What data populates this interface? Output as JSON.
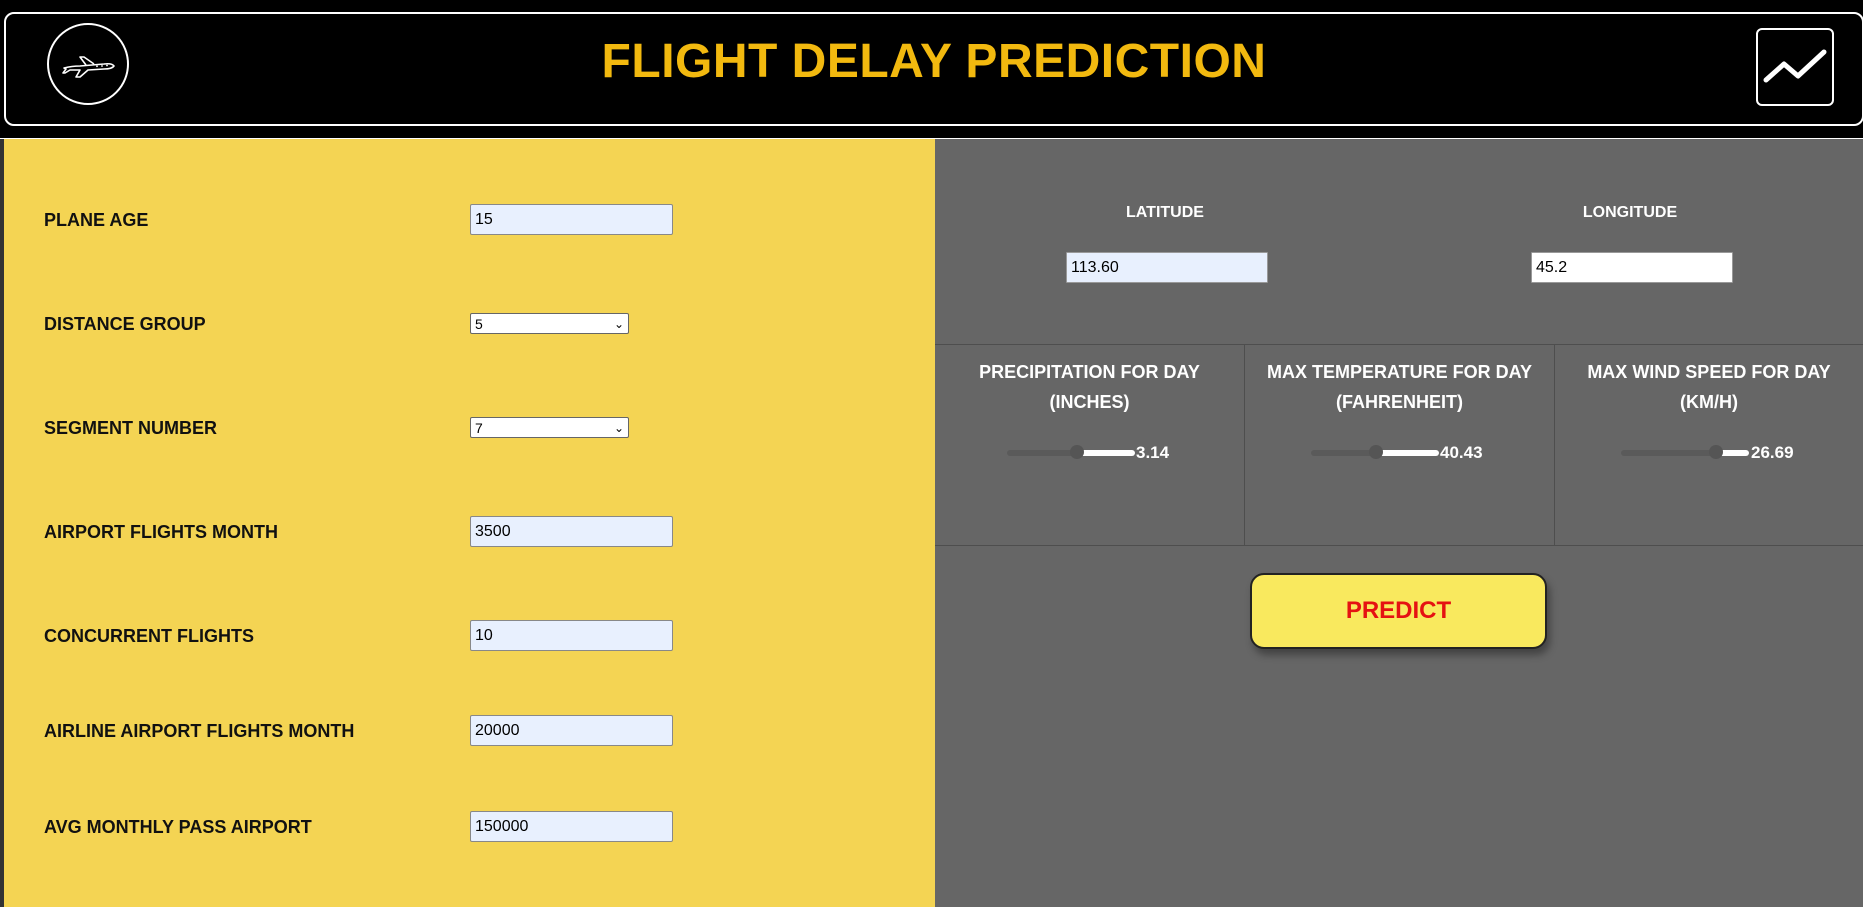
{
  "header": {
    "title": "FLIGHT DELAY PREDICTION",
    "logo_icon": "airplane-icon",
    "chart_icon": "line-chart-icon",
    "title_color": "#f2b90f"
  },
  "form": {
    "plane_age": {
      "label": "PLANE AGE",
      "value": "15"
    },
    "distance_group": {
      "label": "DISTANCE GROUP",
      "value": "5"
    },
    "segment_number": {
      "label": "SEGMENT NUMBER",
      "value": "7"
    },
    "airport_flights_month": {
      "label": "AIRPORT FLIGHTS MONTH",
      "value": "3500"
    },
    "concurrent_flights": {
      "label": "CONCURRENT FLIGHTS",
      "value": "10"
    },
    "airline_airport_flights_month": {
      "label": "AIRLINE AIRPORT FLIGHTS MONTH",
      "value": "20000"
    },
    "avg_monthly_pass_airport": {
      "label": "AVG MONTHLY PASS AIRPORT",
      "value": "150000"
    }
  },
  "location": {
    "latitude": {
      "label": "LATITUDE",
      "value": "113.60"
    },
    "longitude": {
      "label": "LONGITUDE",
      "value": "45.2"
    }
  },
  "weather": {
    "precipitation": {
      "title_line1": "PRECIPITATION FOR DAY",
      "title_line2": "(INCHES)",
      "value": "3.14",
      "level": 0.55
    },
    "max_temp": {
      "title_line1": "MAX TEMPERATURE FOR DAY",
      "title_line2": "(FAHRENHEIT)",
      "value": "40.43",
      "level": 0.51
    },
    "max_wind": {
      "title_line1": "MAX WIND SPEED FOR DAY",
      "title_line2": "(KM/H)",
      "value": "26.69",
      "level": 0.74
    }
  },
  "predict_button": {
    "label": "PREDICT"
  },
  "colors": {
    "left_panel": "#f4d453",
    "right_panel": "#666666",
    "predict_bg": "#f9e95e",
    "predict_text": "#e51212"
  }
}
